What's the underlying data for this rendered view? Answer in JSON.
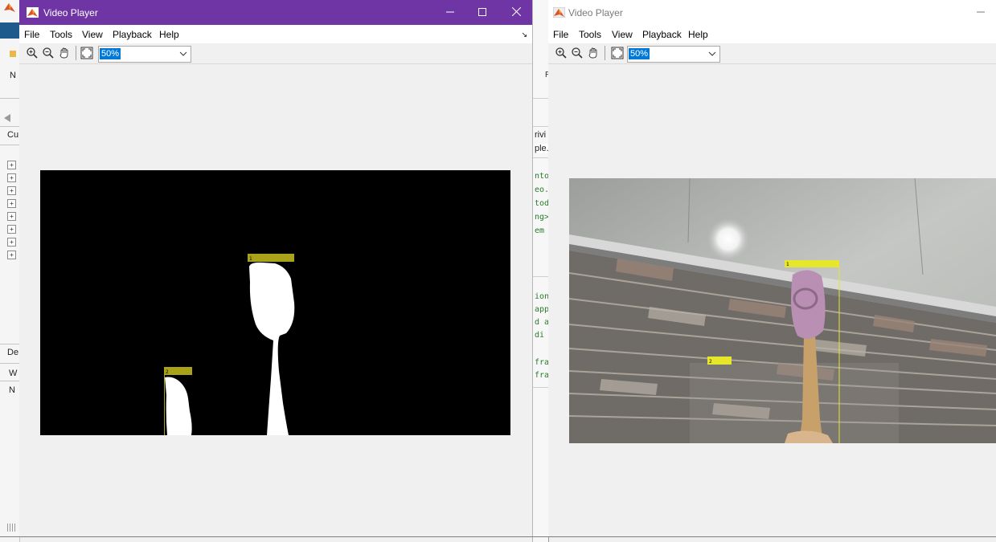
{
  "bg_left": {
    "fragments": [
      "N",
      "Cu",
      "De",
      "W",
      "N"
    ]
  },
  "bg_mid": {
    "text_r": "R",
    "tab_frags": [
      "rivi",
      "ple."
    ],
    "code_top": [
      "nto",
      "eo.",
      "tod",
      "ng>",
      "em"
    ],
    "code_bottom": [
      "ion",
      "app",
      "d a",
      "di",
      "fra",
      "fra"
    ]
  },
  "player_left": {
    "title": "Video Player",
    "menu": [
      "File",
      "Tools",
      "View",
      "Playback",
      "Help"
    ],
    "zoom_value": "50%"
  },
  "player_right": {
    "title": "Video Player",
    "menu": [
      "File",
      "Tools",
      "View",
      "Playback",
      "Help"
    ],
    "zoom_value": "50%"
  },
  "colors": {
    "title_active": "#6f35a5",
    "mask_background": "#000000",
    "mask_blob": "#ffffff",
    "bbox_label": "#a9a31a",
    "bbox_label_bright": "#e6e62a"
  }
}
